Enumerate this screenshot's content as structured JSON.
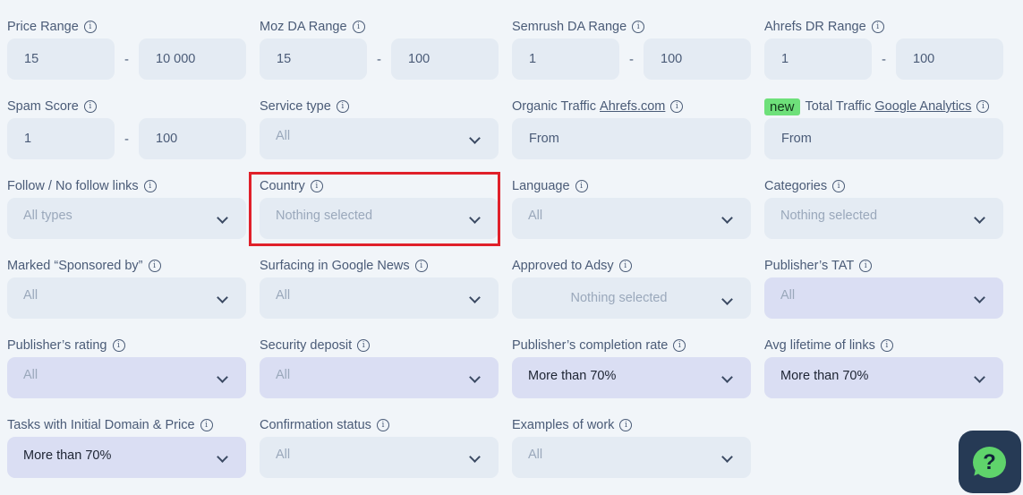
{
  "filters": {
    "price_range": {
      "label": "Price Range",
      "from": "15",
      "to": "10 000",
      "separator": "-"
    },
    "moz_da_range": {
      "label": "Moz DA Range",
      "from": "15",
      "to": "100",
      "separator": "-"
    },
    "semrush_da_range": {
      "label": "Semrush DA Range",
      "from": "1",
      "to": "100",
      "separator": "-"
    },
    "ahrefs_dr_range": {
      "label": "Ahrefs DR Range",
      "from": "1",
      "to": "100",
      "separator": "-"
    },
    "spam_score": {
      "label": "Spam Score",
      "from": "1",
      "to": "100",
      "separator": "-"
    },
    "service_type": {
      "label": "Service type",
      "value": "All"
    },
    "organic_traffic": {
      "label": "Organic Traffic",
      "link": "Ahrefs.com",
      "placeholder": "From"
    },
    "total_traffic": {
      "badge": "new",
      "label": "Total Traffic",
      "link": "Google Analytics",
      "placeholder": "From"
    },
    "follow_links": {
      "label": "Follow / No follow links",
      "value": "All types"
    },
    "country": {
      "label": "Country",
      "value": "Nothing selected"
    },
    "language": {
      "label": "Language",
      "value": "All"
    },
    "categories": {
      "label": "Categories",
      "value": "Nothing selected"
    },
    "sponsored_by": {
      "label": "Marked “Sponsored by”",
      "value": "All"
    },
    "google_news": {
      "label": "Surfacing in Google News",
      "value": "All"
    },
    "approved_adsy": {
      "label": "Approved to Adsy",
      "value": "Nothing selected"
    },
    "publisher_tat": {
      "label": "Publisher’s TAT",
      "value": "All"
    },
    "publisher_rating": {
      "label": "Publisher’s rating",
      "value": "All"
    },
    "security_deposit": {
      "label": "Security deposit",
      "value": "All"
    },
    "completion_rate": {
      "label": "Publisher’s completion rate",
      "value": "More than 70%"
    },
    "avg_lifetime": {
      "label": "Avg lifetime of links",
      "value": "More than 70%"
    },
    "initial_domain_price": {
      "label": "Tasks with Initial Domain & Price",
      "value": "More than 70%"
    },
    "confirmation_status": {
      "label": "Confirmation status",
      "value": "All"
    },
    "examples_of_work": {
      "label": "Examples of work",
      "value": "All"
    }
  },
  "info_glyph": "i",
  "help_button": {
    "glyph": "?"
  },
  "colors": {
    "highlight": "#e0202a",
    "new_badge": "#6ee07a",
    "help_bg": "#263a55"
  }
}
